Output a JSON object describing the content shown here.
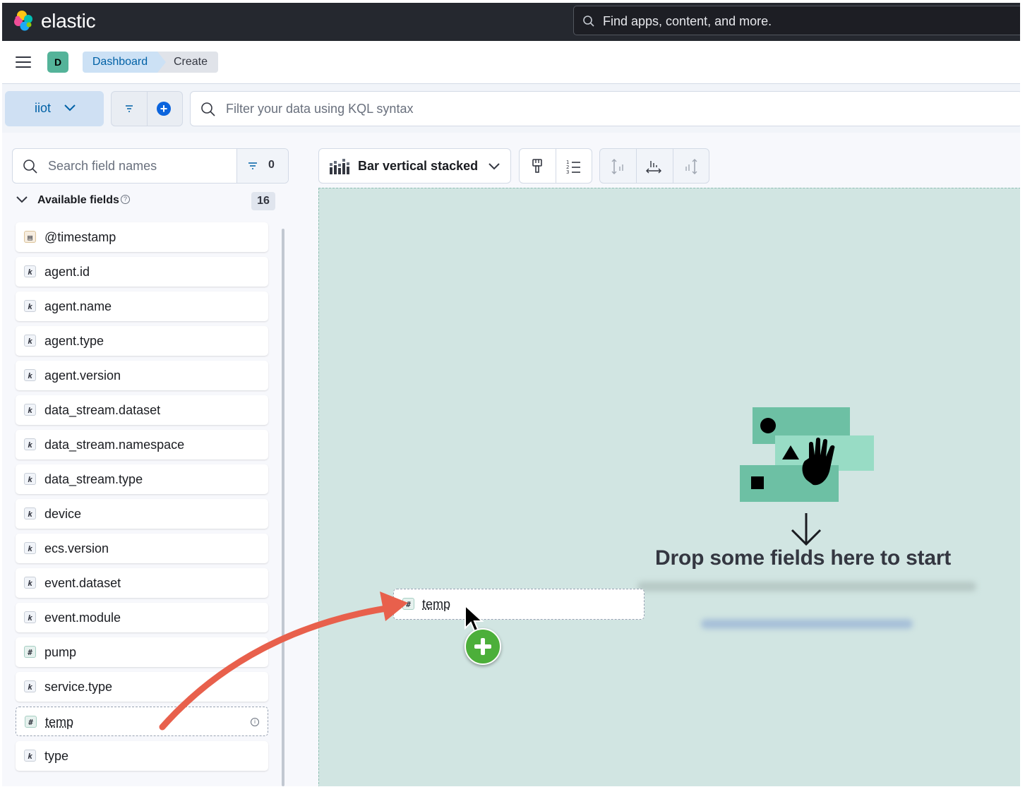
{
  "header": {
    "brand": "elastic",
    "search_placeholder": "Find apps, content, and more."
  },
  "breadcrumbs": {
    "space_initial": "D",
    "items": [
      "Dashboard",
      "Create"
    ]
  },
  "query_bar": {
    "data_view": "iiot",
    "kql_placeholder": "Filter your data using KQL syntax"
  },
  "sidebar": {
    "search_placeholder": "Search field names",
    "filter_count": "0",
    "section_label": "Available fields",
    "section_count": "16",
    "fields": [
      {
        "name": "@timestamp",
        "type": "date",
        "token": "▤"
      },
      {
        "name": "agent.id",
        "type": "keyword",
        "token": "k"
      },
      {
        "name": "agent.name",
        "type": "keyword",
        "token": "k"
      },
      {
        "name": "agent.type",
        "type": "keyword",
        "token": "k"
      },
      {
        "name": "agent.version",
        "type": "keyword",
        "token": "k"
      },
      {
        "name": "data_stream.dataset",
        "type": "keyword",
        "token": "k"
      },
      {
        "name": "data_stream.namespace",
        "type": "keyword",
        "token": "k"
      },
      {
        "name": "data_stream.type",
        "type": "keyword",
        "token": "k"
      },
      {
        "name": "device",
        "type": "keyword",
        "token": "k"
      },
      {
        "name": "ecs.version",
        "type": "keyword",
        "token": "k"
      },
      {
        "name": "event.dataset",
        "type": "keyword",
        "token": "k"
      },
      {
        "name": "event.module",
        "type": "keyword",
        "token": "k"
      },
      {
        "name": "pump",
        "type": "number",
        "token": "#"
      },
      {
        "name": "service.type",
        "type": "keyword",
        "token": "k"
      },
      {
        "name": "temp",
        "type": "number",
        "token": "#",
        "dragging": true
      },
      {
        "name": "type",
        "type": "keyword",
        "token": "k"
      }
    ]
  },
  "workspace": {
    "chart_type": "Bar vertical stacked",
    "drop_title": "Drop some fields here to start",
    "drag_field": "temp",
    "drag_token": "#"
  },
  "colors": {
    "header_bg": "#25282f",
    "accent": "#0b64dd",
    "workspace_bg": "#d1e5e2",
    "arrow": "#e8604c",
    "add_badge": "#4caf3a"
  }
}
